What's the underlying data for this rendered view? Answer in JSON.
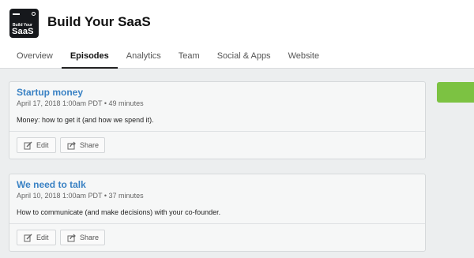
{
  "app": {
    "logo_line1": "Build Your",
    "logo_line2": "SaaS",
    "title": "Build Your SaaS"
  },
  "tabs": [
    {
      "label": "Overview",
      "active": false
    },
    {
      "label": "Episodes",
      "active": true
    },
    {
      "label": "Analytics",
      "active": false
    },
    {
      "label": "Team",
      "active": false
    },
    {
      "label": "Social & Apps",
      "active": false
    },
    {
      "label": "Website",
      "active": false
    }
  ],
  "episodes": [
    {
      "title": "Startup money",
      "meta": "April 17, 2018 1:00am PDT • 49 minutes",
      "description": "Money: how to get it (and how we spend it).",
      "edit_label": "Edit",
      "share_label": "Share"
    },
    {
      "title": "We need to talk",
      "meta": "April 10, 2018 1:00am PDT • 37 minutes",
      "description": "How to communicate (and make decisions) with your co-founder.",
      "edit_label": "Edit",
      "share_label": "Share"
    }
  ],
  "colors": {
    "accent_green": "#7cc242",
    "link_blue": "#3a82c4"
  }
}
